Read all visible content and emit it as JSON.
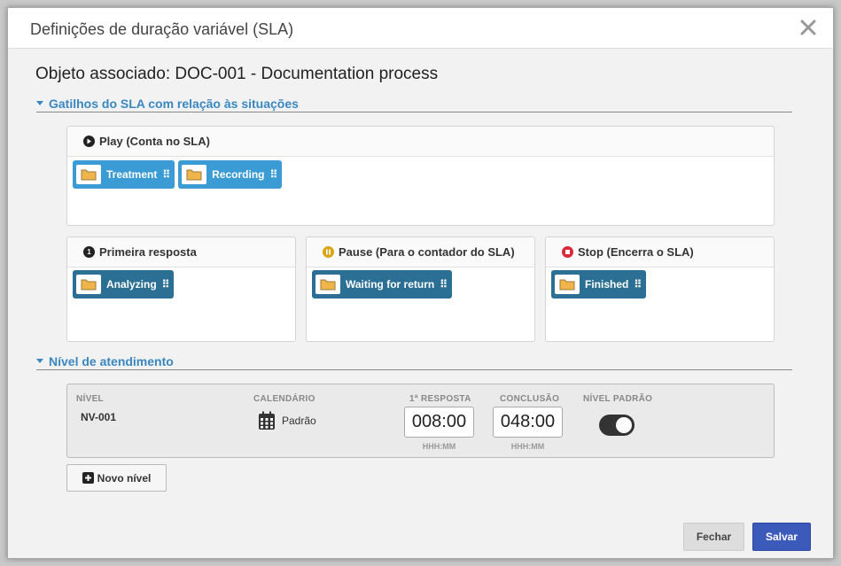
{
  "dialog": {
    "title": "Definições de duração variável (SLA)",
    "subject": "Objeto associado: DOC-001 - Documentation process"
  },
  "triggers": {
    "section_label": "Gatilhos do SLA com relação às situações",
    "play": {
      "title": "Play (Conta no SLA)",
      "icon": "play-icon",
      "items": [
        "Treatment",
        "Recording"
      ]
    },
    "first_response": {
      "title": "Primeira resposta",
      "icon": "number-one-icon",
      "badge": "1",
      "items": [
        "Analyzing"
      ]
    },
    "pause": {
      "title": "Pause (Para o contador do SLA)",
      "icon": "pause-icon",
      "items": [
        "Waiting for return"
      ]
    },
    "stop": {
      "title": "Stop (Encerra o SLA)",
      "icon": "stop-icon",
      "items": [
        "Finished"
      ]
    }
  },
  "service_level": {
    "section_label": "Nível de atendimento",
    "columns": {
      "level": "NÍVEL",
      "calendar": "CALENDÁRIO",
      "first_response": "1ª RESPOSTA",
      "conclusion": "CONCLUSÃO",
      "default_level": "NÍVEL PADRÃO"
    },
    "row": {
      "level": "NV-001",
      "calendar": "Padrão",
      "first_response": "008:00",
      "first_response_hint": "HHH:MM",
      "conclusion": "048:00",
      "conclusion_hint": "HHH:MM",
      "default_level_on": true
    },
    "new_level_label": "Novo nível"
  },
  "footer": {
    "close_label": "Fechar",
    "save_label": "Salvar"
  },
  "colors": {
    "accent": "#3a87c0",
    "chip_light": "#3a9bd5",
    "chip_dark": "#2b6f95",
    "pause": "#d9a514",
    "stop": "#d9293a",
    "save": "#3c5ab9"
  }
}
